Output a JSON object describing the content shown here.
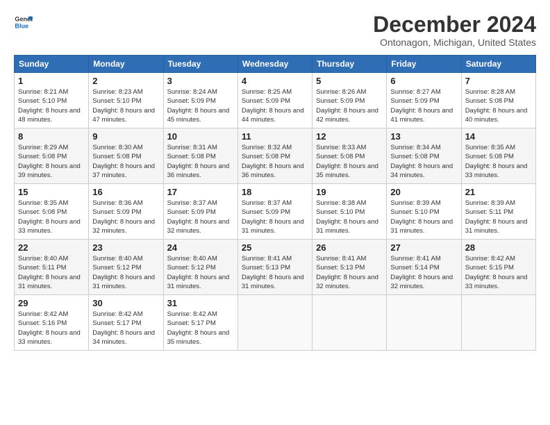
{
  "header": {
    "logo_line1": "General",
    "logo_line2": "Blue",
    "month_title": "December 2024",
    "location": "Ontonagon, Michigan, United States"
  },
  "days_of_week": [
    "Sunday",
    "Monday",
    "Tuesday",
    "Wednesday",
    "Thursday",
    "Friday",
    "Saturday"
  ],
  "weeks": [
    [
      {
        "day": "1",
        "info": "Sunrise: 8:21 AM\nSunset: 5:10 PM\nDaylight: 8 hours and 48 minutes."
      },
      {
        "day": "2",
        "info": "Sunrise: 8:23 AM\nSunset: 5:10 PM\nDaylight: 8 hours and 47 minutes."
      },
      {
        "day": "3",
        "info": "Sunrise: 8:24 AM\nSunset: 5:09 PM\nDaylight: 8 hours and 45 minutes."
      },
      {
        "day": "4",
        "info": "Sunrise: 8:25 AM\nSunset: 5:09 PM\nDaylight: 8 hours and 44 minutes."
      },
      {
        "day": "5",
        "info": "Sunrise: 8:26 AM\nSunset: 5:09 PM\nDaylight: 8 hours and 42 minutes."
      },
      {
        "day": "6",
        "info": "Sunrise: 8:27 AM\nSunset: 5:09 PM\nDaylight: 8 hours and 41 minutes."
      },
      {
        "day": "7",
        "info": "Sunrise: 8:28 AM\nSunset: 5:08 PM\nDaylight: 8 hours and 40 minutes."
      }
    ],
    [
      {
        "day": "8",
        "info": "Sunrise: 8:29 AM\nSunset: 5:08 PM\nDaylight: 8 hours and 39 minutes."
      },
      {
        "day": "9",
        "info": "Sunrise: 8:30 AM\nSunset: 5:08 PM\nDaylight: 8 hours and 37 minutes."
      },
      {
        "day": "10",
        "info": "Sunrise: 8:31 AM\nSunset: 5:08 PM\nDaylight: 8 hours and 36 minutes."
      },
      {
        "day": "11",
        "info": "Sunrise: 8:32 AM\nSunset: 5:08 PM\nDaylight: 8 hours and 36 minutes."
      },
      {
        "day": "12",
        "info": "Sunrise: 8:33 AM\nSunset: 5:08 PM\nDaylight: 8 hours and 35 minutes."
      },
      {
        "day": "13",
        "info": "Sunrise: 8:34 AM\nSunset: 5:08 PM\nDaylight: 8 hours and 34 minutes."
      },
      {
        "day": "14",
        "info": "Sunrise: 8:35 AM\nSunset: 5:08 PM\nDaylight: 8 hours and 33 minutes."
      }
    ],
    [
      {
        "day": "15",
        "info": "Sunrise: 8:35 AM\nSunset: 5:08 PM\nDaylight: 8 hours and 33 minutes."
      },
      {
        "day": "16",
        "info": "Sunrise: 8:36 AM\nSunset: 5:09 PM\nDaylight: 8 hours and 32 minutes."
      },
      {
        "day": "17",
        "info": "Sunrise: 8:37 AM\nSunset: 5:09 PM\nDaylight: 8 hours and 32 minutes."
      },
      {
        "day": "18",
        "info": "Sunrise: 8:37 AM\nSunset: 5:09 PM\nDaylight: 8 hours and 31 minutes."
      },
      {
        "day": "19",
        "info": "Sunrise: 8:38 AM\nSunset: 5:10 PM\nDaylight: 8 hours and 31 minutes."
      },
      {
        "day": "20",
        "info": "Sunrise: 8:39 AM\nSunset: 5:10 PM\nDaylight: 8 hours and 31 minutes."
      },
      {
        "day": "21",
        "info": "Sunrise: 8:39 AM\nSunset: 5:11 PM\nDaylight: 8 hours and 31 minutes."
      }
    ],
    [
      {
        "day": "22",
        "info": "Sunrise: 8:40 AM\nSunset: 5:11 PM\nDaylight: 8 hours and 31 minutes."
      },
      {
        "day": "23",
        "info": "Sunrise: 8:40 AM\nSunset: 5:12 PM\nDaylight: 8 hours and 31 minutes."
      },
      {
        "day": "24",
        "info": "Sunrise: 8:40 AM\nSunset: 5:12 PM\nDaylight: 8 hours and 31 minutes."
      },
      {
        "day": "25",
        "info": "Sunrise: 8:41 AM\nSunset: 5:13 PM\nDaylight: 8 hours and 31 minutes."
      },
      {
        "day": "26",
        "info": "Sunrise: 8:41 AM\nSunset: 5:13 PM\nDaylight: 8 hours and 32 minutes."
      },
      {
        "day": "27",
        "info": "Sunrise: 8:41 AM\nSunset: 5:14 PM\nDaylight: 8 hours and 32 minutes."
      },
      {
        "day": "28",
        "info": "Sunrise: 8:42 AM\nSunset: 5:15 PM\nDaylight: 8 hours and 33 minutes."
      }
    ],
    [
      {
        "day": "29",
        "info": "Sunrise: 8:42 AM\nSunset: 5:16 PM\nDaylight: 8 hours and 33 minutes."
      },
      {
        "day": "30",
        "info": "Sunrise: 8:42 AM\nSunset: 5:17 PM\nDaylight: 8 hours and 34 minutes."
      },
      {
        "day": "31",
        "info": "Sunrise: 8:42 AM\nSunset: 5:17 PM\nDaylight: 8 hours and 35 minutes."
      },
      {
        "day": "",
        "info": ""
      },
      {
        "day": "",
        "info": ""
      },
      {
        "day": "",
        "info": ""
      },
      {
        "day": "",
        "info": ""
      }
    ]
  ]
}
